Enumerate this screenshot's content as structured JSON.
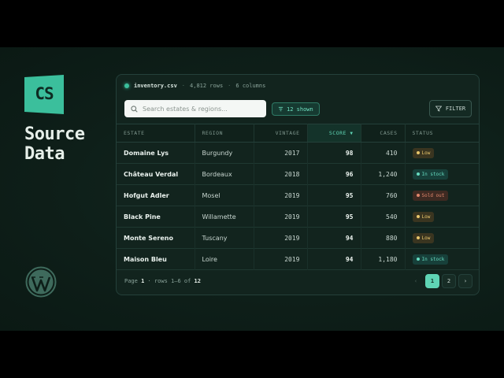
{
  "brand": {
    "logo_text": "CS",
    "title_line1": "Source",
    "title_line2": "Data"
  },
  "panel": {
    "file_name": "inventory.csv",
    "sep": "·",
    "rows_info": "4,812 rows",
    "columns_info": "6 columns",
    "search_placeholder": "Search estates & regions...",
    "chip_label": "12 shown",
    "filter_label": "FILTER"
  },
  "table": {
    "headers": {
      "estate": "ESTATE",
      "region": "REGION",
      "vintage": "VINTAGE",
      "score": "SCORE",
      "cases": "CASES",
      "status": "STATUS"
    },
    "rows": [
      {
        "estate": "Domaine Lys",
        "region": "Burgundy",
        "vintage": "2017",
        "score": "98",
        "cases": "410",
        "status": "Low"
      },
      {
        "estate": "Château Verdal",
        "region": "Bordeaux",
        "vintage": "2018",
        "score": "96",
        "cases": "1,240",
        "status": "In stock"
      },
      {
        "estate": "Hofgut Adler",
        "region": "Mosel",
        "vintage": "2019",
        "score": "95",
        "cases": "760",
        "status": "Sold out"
      },
      {
        "estate": "Black Pine",
        "region": "Willamette",
        "vintage": "2019",
        "score": "95",
        "cases": "540",
        "status": "Low"
      },
      {
        "estate": "Monte Sereno",
        "region": "Tuscany",
        "vintage": "2019",
        "score": "94",
        "cases": "880",
        "status": "Low"
      },
      {
        "estate": "Maison Bleu",
        "region": "Loire",
        "vintage": "2019",
        "score": "94",
        "cases": "1,180",
        "status": "In stock"
      }
    ]
  },
  "footer": {
    "page_label": "Page",
    "page_number": "1",
    "rows_text": "· rows 1–6 of",
    "total": "12",
    "pages": [
      "1",
      "2"
    ],
    "prev": "‹",
    "next": "›"
  },
  "colors": {
    "accent": "#5fd4b4",
    "low": "#e8c66b",
    "in_stock": "#66dcc0",
    "sold_out": "#e0866b"
  },
  "icons": [
    "search-icon",
    "filter-icon",
    "funnel-icon",
    "sort-desc-icon",
    "wordpress-icon"
  ]
}
